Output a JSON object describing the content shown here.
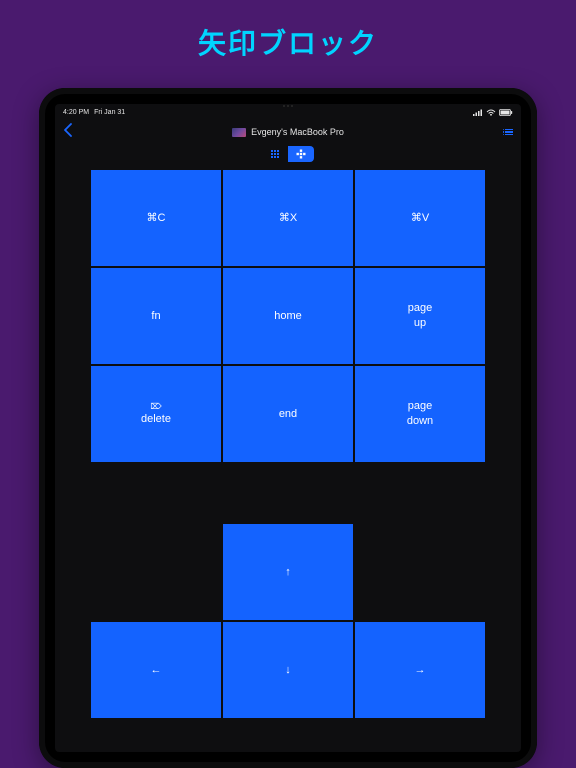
{
  "page": {
    "title": "矢印ブロック"
  },
  "status": {
    "time": "4:20 PM",
    "date": "Fri Jan 31"
  },
  "nav": {
    "host": "Evgeny's MacBook Pro"
  },
  "segmented": {
    "index": 1
  },
  "keys": {
    "grid1": [
      {
        "label": "⌘C"
      },
      {
        "label": "⌘X"
      },
      {
        "label": "⌘V"
      },
      {
        "label": "fn"
      },
      {
        "label": "home"
      },
      {
        "label": "page\nup",
        "two": [
          "page",
          "up"
        ]
      },
      {
        "label": "delete",
        "mini": "⌦"
      },
      {
        "label": "end"
      },
      {
        "label": "page\ndown",
        "two": [
          "page",
          "down"
        ]
      }
    ],
    "arrows": {
      "up": "↑",
      "left": "←",
      "down": "↓",
      "right": "→"
    }
  }
}
